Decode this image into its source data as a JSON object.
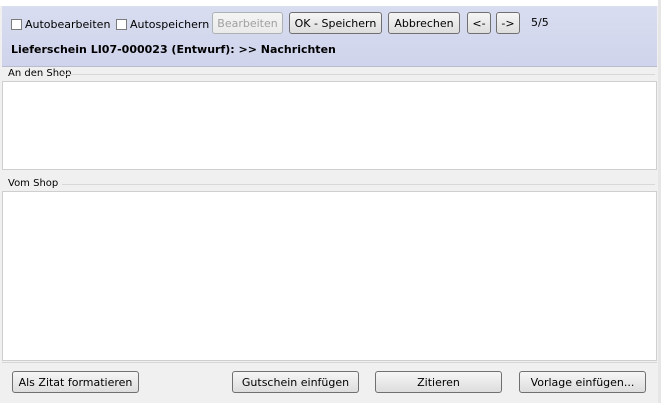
{
  "toolbar": {
    "autobearbeiten_label": "Autobearbeiten",
    "autospeichern_label": "Autospeichern",
    "bearbeiten_label": "Bearbeiten",
    "ok_speichern_label": "OK - Speichern",
    "abbrechen_label": "Abbrechen",
    "prev_label": "<-",
    "next_label": "->",
    "counter": "5/5",
    "autobearbeiten_checked": false,
    "autospeichern_checked": false
  },
  "header": {
    "title": "Lieferschein LI07-000023 (Entwurf):  >> Nachrichten"
  },
  "sections": {
    "to_shop_label": "An den Shop",
    "from_shop_label": "Vom Shop",
    "to_shop_text": "",
    "from_shop_text": ""
  },
  "bottom": {
    "als_zitat_label": "Als Zitat formatieren",
    "gutschein_label": "Gutschein einfügen",
    "zitieren_label": "Zitieren",
    "vorlage_label": "Vorlage einfügen..."
  }
}
